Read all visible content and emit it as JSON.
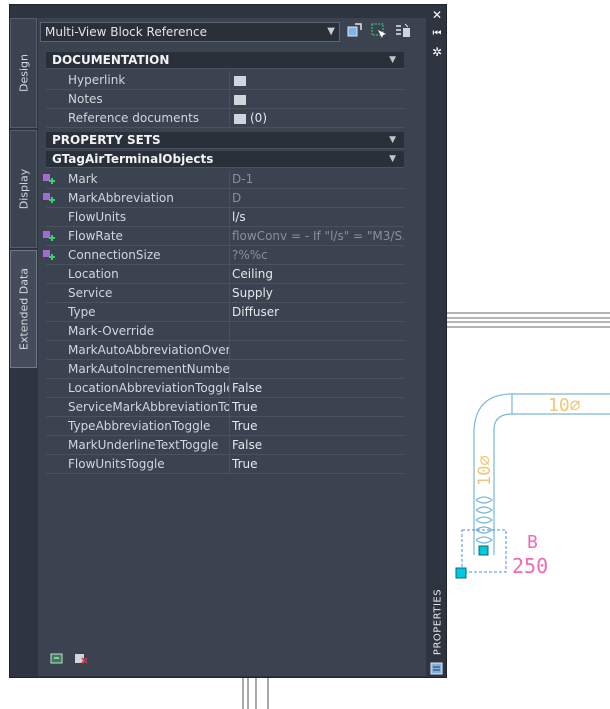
{
  "tabs": [
    "Design",
    "Display",
    "Extended Data"
  ],
  "header": {
    "combo_value": "Multi-View Block Reference"
  },
  "documentation": {
    "title": "DOCUMENTATION",
    "rows": [
      {
        "name": "Hyperlink",
        "value": ""
      },
      {
        "name": "Notes",
        "value": ""
      },
      {
        "name": "Reference documents",
        "value": "(0)"
      }
    ]
  },
  "property_sets": {
    "title": "PROPERTY SETS",
    "subtitle": "GTagAirTerminalObjects",
    "rows": [
      {
        "name": "Mark",
        "value": "D-1"
      },
      {
        "name": "MarkAbbreviation",
        "value": "D"
      },
      {
        "name": "FlowUnits",
        "value": "l/s"
      },
      {
        "name": "FlowRate",
        "value": "flowConv = - If \"l/s\" = \"M3/S..."
      },
      {
        "name": "ConnectionSize",
        "value": "?%%c"
      },
      {
        "name": "Location",
        "value": "Ceiling"
      },
      {
        "name": "Service",
        "value": "Supply"
      },
      {
        "name": "Type",
        "value": "Diffuser"
      },
      {
        "name": "Mark-Override",
        "value": ""
      },
      {
        "name": "MarkAutoAbbreviationOver...",
        "value": ""
      },
      {
        "name": "MarkAutoIncrementNumbe...",
        "value": ""
      },
      {
        "name": "LocationAbbreviationToggle",
        "value": "False"
      },
      {
        "name": "ServiceMarkAbbreviationTo...",
        "value": "True"
      },
      {
        "name": "TypeAbbreviationToggle",
        "value": "True"
      },
      {
        "name": "MarkUnderlineTextToggle",
        "value": "False"
      },
      {
        "name": "FlowUnitsToggle",
        "value": "True"
      }
    ]
  },
  "sidebar": {
    "label": "PROPERTIES"
  },
  "drawing": {
    "duct_label_h": "10⌀",
    "duct_label_v": "10⌀",
    "tag_letter": "B",
    "tag_number": "250"
  },
  "colors": {
    "duct": "#7ab7d8",
    "duct_label": "#f0c77a",
    "tag": "#f06cb0",
    "grip": "#00c8e0",
    "panel": "#3b4250",
    "header": "#2a3039"
  }
}
